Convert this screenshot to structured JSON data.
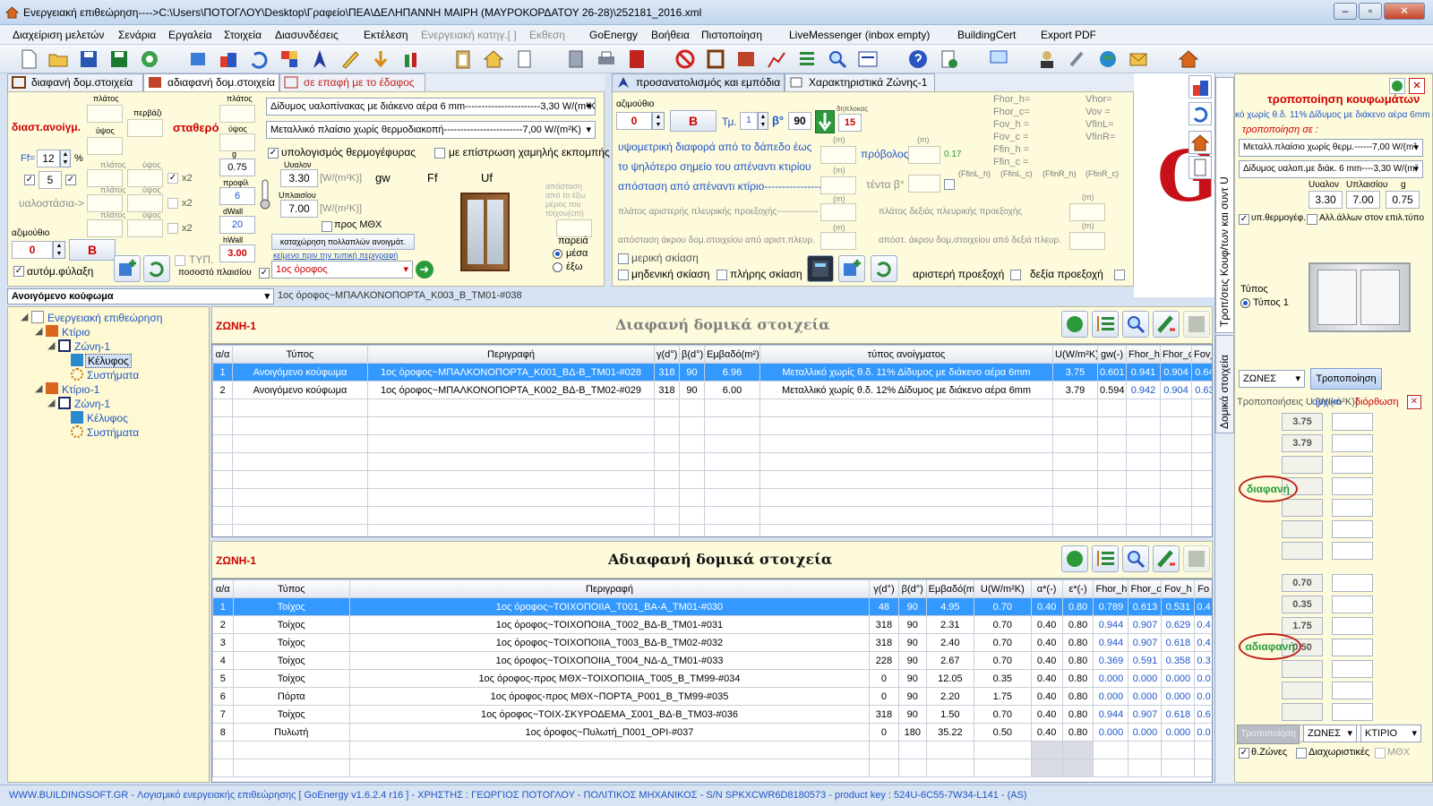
{
  "window": {
    "title": "Ενεργειακή επιθεώρηση---->C:\\Users\\ΠΟΤΟΓΛΟΥ\\Desktop\\Γραφείο\\ΠΕΑ\\ΔΕΛΗΠΑΝΝΗ ΜΑΙΡΗ (ΜΑΥΡΟΚΟΡΔΑΤΟΥ 26-28)\\252181_2016.xml",
    "min": "–",
    "max": "▫",
    "close": "✕"
  },
  "menu": [
    "Διαχείριση μελετών",
    "Σενάρια",
    "Εργαλεία",
    "Στοιχεία",
    "Διασυνδέσεις",
    "Εκτέλεση",
    "Ενεργειακή κατηγ.[ ]",
    "Εκθεση",
    "GoEnergy",
    "Βοήθεια",
    "Πιστοποίηση",
    "LiveMessenger (inbox empty)",
    "BuildingCert",
    "Export PDF"
  ],
  "tabs_left": [
    "διαφανή δομ.στοιχεία",
    "αδιαφανή δομ.στοιχεία",
    "σε επαφή με το έδαφος"
  ],
  "tabs_mid": [
    "προσανατολισμός και εμπόδια",
    "Χαρακτηριστικά Ζώνης-1"
  ],
  "left_form": {
    "dims": "διαστ.ανοίγμ.",
    "fixed": "σταθερό",
    "platos": "πλάτος",
    "ypsos": "ύψος",
    "perv": "περβάζι",
    "ff_label": "Ff=",
    "ff": "12",
    "pct": "%",
    "count": "5",
    "x2": "x2",
    "glass_struts": "υαλοστάσια->",
    "azimuth_label": "αζιμούθιο",
    "azimuth": "0",
    "b_btn": "B",
    "autosave": "αυτόμ.φύλαξη",
    "typ": "ΤΥΠ.",
    "frame_pct": "ποσοστό πλαισίου",
    "g_label": "g",
    "g": "0.75",
    "profile_label": "προφίλ",
    "profile": "6",
    "dwall_label": "dWall",
    "dwall": "20",
    "hwall_label": "hWall",
    "hwall": "3.00",
    "glass": "Δίδυμος υαλοπίνακας με διάκενο αέρα 6 mm-----------------------3,30 W/(m²K)",
    "frame": "Μεταλλικό πλαίσιο χωρίς θερμοδιακοπή------------------------7,00 W/(m²K)",
    "calc_therm": "υπολογισμός θερμογέφυρας",
    "low_e": "με επίστρωση χαμηλής εκπομπής",
    "uglass_label": "Uυαλον",
    "uglass": "3.30",
    "uframe_label": "Uπλαισίου",
    "uframe": "7.00",
    "unit": "[W/(m²K)]",
    "gw": "gw",
    "ff2": "Ff",
    "uf": "Uf",
    "to_mthx": "προς ΜΘΧ",
    "multi_btn": "καταχώρηση πολλαπλών ανοιγμάτ.",
    "desc_hint": "κείμενο πριν την τυπική περιγραφή",
    "floor": "1ος όροφος",
    "dist_hint": "απόσταση από το έξω μέρος του τοίχου(cm)",
    "pareia": "παρειά",
    "inside": "μέσα",
    "outside": "έξω"
  },
  "opening_select": "Ανοιγόμενο κούφωμα",
  "opening_path": "1ος όροφος~ΜΠΑΛΚΟΝΟΠΟΡΤΑ_Κ003_Β_ΤΜ01-#038",
  "mid_form": {
    "azimuth_label": "αζιμούθιο",
    "azimuth": "0",
    "b": "B",
    "tm": "Τμ.",
    "tm_val": "1",
    "beta": "β°",
    "beta_val": "90",
    "diplokas_label": "δηπλοκας",
    "diplokas": "15",
    "l1": "υψομετρική διαφορά από το δάπεδο έως",
    "l2": "το ψηλότερο σημείο του απέναντι κτιρίου",
    "l3": "απόσταση από απέναντι κτίριο--------------------",
    "m": "(m)",
    "provolos": "πρόβολος",
    "pv": "0.17",
    "tenta": "τέντα β°",
    "lw": "πλάτος αριστερής πλευρικής προεξοχής--------------",
    "rw": "πλάτος δεξιάς πλευρικής προεξοχής",
    "ld": "απόσταση άκρου δομ.στοιχείου από αριστ.πλευρ.",
    "rd": "απόστ. άκρου δομ.στοιχείου από δεξιά πλευρ.",
    "partial": "μερική σκίαση",
    "none": "μηδενική σκίαση",
    "full": "πλήρης σκίαση",
    "left_proj": "αριστερή προεξοχή",
    "right_proj": "δεξία προεξοχή",
    "fn": [
      "Fhor_h=",
      "Fhor_c=",
      "Fov_h =",
      "Fov_c =",
      "Ffin_h =",
      "Ffin_c ="
    ],
    "vn": [
      "Vhor=",
      "Vov =",
      "VfinL=",
      "VfinR="
    ],
    "fin": [
      "(FfinL_h)",
      "(FfinL_c)",
      "(FfinR_h)",
      "(FfinR_c)"
    ]
  },
  "tree": {
    "root": "Ενεργειακή επιθεώρηση",
    "b1": "Κτίριο",
    "z1": "Ζώνη-1",
    "shell1": "Κέλυφος",
    "sys1": "Συστήματα",
    "b2": "Κτίριο-1",
    "z2": "Ζώνη-1",
    "shell2": "Κέλυφος",
    "sys2": "Συστήματα"
  },
  "transparent": {
    "zone": "ΖΩΝΗ-1",
    "title": "Διαφανή δομικά στοιχεία",
    "headers": [
      "α/α",
      "Τύπος",
      "Περιγραφή",
      "γ(d°)",
      "β(d°)",
      "Εμβαδό(m²)",
      "τύπος ανοίγματος",
      "U(W/m²K)",
      "gw(-)",
      "Fhor_h",
      "Fhor_c",
      "Fov_h"
    ],
    "rows": [
      [
        "1",
        "Ανοιγόμενο κούφωμα",
        "1ος όροφος~ΜΠΑΛΚΟΝΟΠΟΡΤΑ_Κ001_ΒΔ-Β_ΤΜ01-#028",
        "318",
        "90",
        "6.96",
        "Μεταλλικό χωρίς θ.δ. 11% Δίδυμος με διάκενο αέρα 6mm",
        "3.75",
        "0.601",
        "0.941",
        "0.904",
        "0.642"
      ],
      [
        "2",
        "Ανοιγόμενο κούφωμα",
        "1ος όροφος~ΜΠΑΛΚΟΝΟΠΟΡΤΑ_Κ002_ΒΔ-Β_ΤΜ02-#029",
        "318",
        "90",
        "6.00",
        "Μεταλλικό χωρίς θ.δ. 12% Δίδυμος με διάκενο αέρα 6mm",
        "3.79",
        "0.594",
        "0.942",
        "0.904",
        "0.631"
      ]
    ]
  },
  "opaque": {
    "zone": "ΖΩΝΗ-1",
    "title": "Αδιαφανή δομικά στοιχεία",
    "headers": [
      "α/α",
      "Τύπος",
      "Περιγραφή",
      "γ(d°)",
      "β(d°)",
      "Εμβαδό(m²)",
      "U(W/m²K)",
      "α*(-)",
      "ε*(-)",
      "Fhor_h",
      "Fhor_c",
      "Fov_h",
      "Fo"
    ],
    "rows": [
      [
        "1",
        "Τοίχος",
        "1ος όροφος~ΤΟΙΧΟΠΟΙΙΑ_Τ001_ΒΑ-Α_ΤΜ01-#030",
        "48",
        "90",
        "4.95",
        "0.70",
        "0.40",
        "0.80",
        "0.789",
        "0.613",
        "0.531",
        "0.4"
      ],
      [
        "2",
        "Τοίχος",
        "1ος όροφος~ΤΟΙΧΟΠΟΙΙΑ_Τ002_ΒΔ-Β_ΤΜ01-#031",
        "318",
        "90",
        "2.31",
        "0.70",
        "0.40",
        "0.80",
        "0.944",
        "0.907",
        "0.629",
        "0.4"
      ],
      [
        "3",
        "Τοίχος",
        "1ος όροφος~ΤΟΙΧΟΠΟΙΙΑ_Τ003_ΒΔ-Β_ΤΜ02-#032",
        "318",
        "90",
        "2.40",
        "0.70",
        "0.40",
        "0.80",
        "0.944",
        "0.907",
        "0.618",
        "0.4"
      ],
      [
        "4",
        "Τοίχος",
        "1ος όροφος~ΤΟΙΧΟΠΟΙΙΑ_Τ004_ΝΔ-Δ_ΤΜ01-#033",
        "228",
        "90",
        "2.67",
        "0.70",
        "0.40",
        "0.80",
        "0.369",
        "0.591",
        "0.358",
        "0.3"
      ],
      [
        "5",
        "Τοίχος",
        "1ος όροφος-προς ΜΘΧ~ΤΟΙΧΟΠΟΙΙΑ_Τ005_Β_ΤΜ99-#034",
        "0",
        "90",
        "12.05",
        "0.35",
        "0.40",
        "0.80",
        "0.000",
        "0.000",
        "0.000",
        "0.0"
      ],
      [
        "6",
        "Πόρτα",
        "1ος όροφος-προς ΜΘΧ~ΠΟΡΤΑ_Ρ001_Β_ΤΜ99-#035",
        "0",
        "90",
        "2.20",
        "1.75",
        "0.40",
        "0.80",
        "0.000",
        "0.000",
        "0.000",
        "0.0"
      ],
      [
        "7",
        "Τοίχος",
        "1ος όροφος~ΤΟΙΧ-ΣΚΥΡΟΔΕΜΑ_Σ001_ΒΔ-Β_ΤΜ03-#036",
        "318",
        "90",
        "1.50",
        "0.70",
        "0.40",
        "0.80",
        "0.944",
        "0.907",
        "0.618",
        "0.6"
      ],
      [
        "8",
        "Πυλωτή",
        "1ος όροφος~Πυλωτή_Π001_ΟΡΙ-#037",
        "0",
        "180",
        "35.22",
        "0.50",
        "0.40",
        "0.80",
        "0.000",
        "0.000",
        "0.000",
        "0.0"
      ]
    ]
  },
  "vtabs": [
    "Τροπ/σεις Κουφ/των και συντ U",
    "Δομικά στοιχεία"
  ],
  "right": {
    "title": "τροποποίηση κουφωμάτων",
    "sub": "κό χωρίς θ.δ. 11% Δίδυμος με διάκενο αέρα 6mm (",
    "mod_in": "τροποποίηση σε :",
    "frame": "Μεταλλ.πλαίσιο χωρίς θερμ.------7,00 W/(m²",
    "glass": "Δίδυμος υαλοπ.με διάκ. 6 mm----3,30 W/(m²",
    "uglass_l": "Uυαλον",
    "uframe_l": "Uπλαισίου",
    "g_l": "g",
    "uglass": "3.30",
    "uframe": "7.00",
    "g": "0.75",
    "therm": "υπ.θερμογέφ.",
    "other": "Αλλ.άλλων στον επιλ.τύπο",
    "typos": "Τύπος",
    "typos1": "Τύπος 1",
    "zones": "ΖΩΝΕΣ",
    "modify": "Τροποποίηση",
    "modify2": "Τροποποίηση",
    "zones2": "ΖΩΝΕΣ",
    "building": "ΚΤΙΡΙΟ",
    "mods": "Τροποποιήσεις U [W/(m²K)]",
    "orig": "αρχικό",
    "fix": "διόρθωση",
    "trans_vals": [
      "3.75",
      "3.79",
      "",
      "",
      "",
      "",
      ""
    ],
    "opaque_vals": [
      "0.70",
      "0.35",
      "1.75",
      "0.50",
      "",
      "",
      "",
      ""
    ],
    "transp": "διαφανή",
    "opaq": "αδιαφανή",
    "zones_chk": "θ.Ζώνες",
    "dividers": "Διαχωριστικές",
    "mthx": "ΜΘΧ"
  },
  "logo_text": "Gc",
  "status": "WWW.BUILDINGSOFT.GR - Λογισμικό ενεργειακής επιθεώρησης [ GoEnergy v1.6.2.4 r16 ]  -  ΧΡΗΣΤΗΣ : ΓΕΩΡΓΙΟΣ ΠΟΤΟΓΛΟΥ - ΠΟΛΙΤΙΚΟΣ ΜΗΧΑΝΙΚΟΣ - S/N SPKXCWR6D8180573 - product key : 524U-6C55-7W34-L141  - (AS)"
}
